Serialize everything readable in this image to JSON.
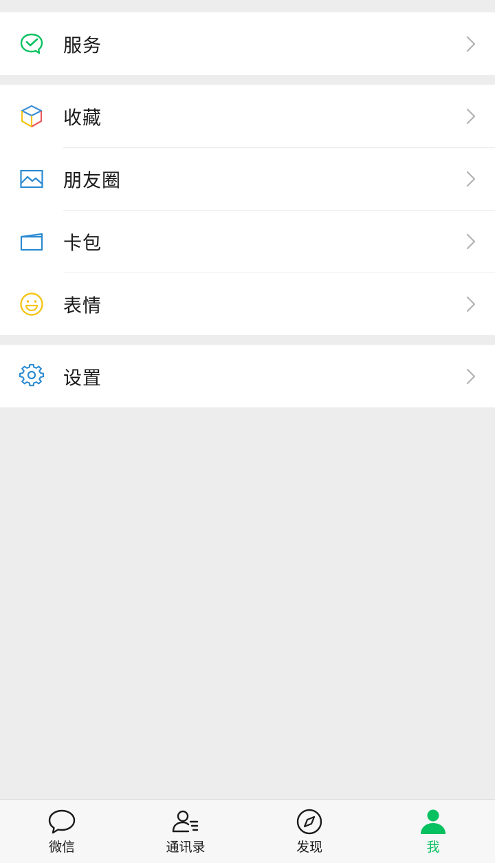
{
  "groups": [
    {
      "items": [
        {
          "label": "服务",
          "icon": "wechat-pay-icon"
        }
      ]
    },
    {
      "items": [
        {
          "label": "收藏",
          "icon": "favorites-cube-icon"
        },
        {
          "label": "朋友圈",
          "icon": "moments-photo-icon"
        },
        {
          "label": "卡包",
          "icon": "card-wallet-icon"
        },
        {
          "label": "表情",
          "icon": "smiley-icon"
        }
      ]
    },
    {
      "items": [
        {
          "label": "设置",
          "icon": "settings-gear-icon"
        }
      ]
    }
  ],
  "tabbar": {
    "tabs": [
      {
        "label": "微信",
        "icon": "chat-bubble-icon",
        "active": false
      },
      {
        "label": "通讯录",
        "icon": "contacts-icon",
        "active": false
      },
      {
        "label": "发现",
        "icon": "compass-icon",
        "active": false
      },
      {
        "label": "我",
        "icon": "person-icon",
        "active": true
      }
    ]
  },
  "colors": {
    "accent": "#07c160",
    "background": "#ededed",
    "surface": "#ffffff",
    "tabbar": "#f7f7f7"
  }
}
